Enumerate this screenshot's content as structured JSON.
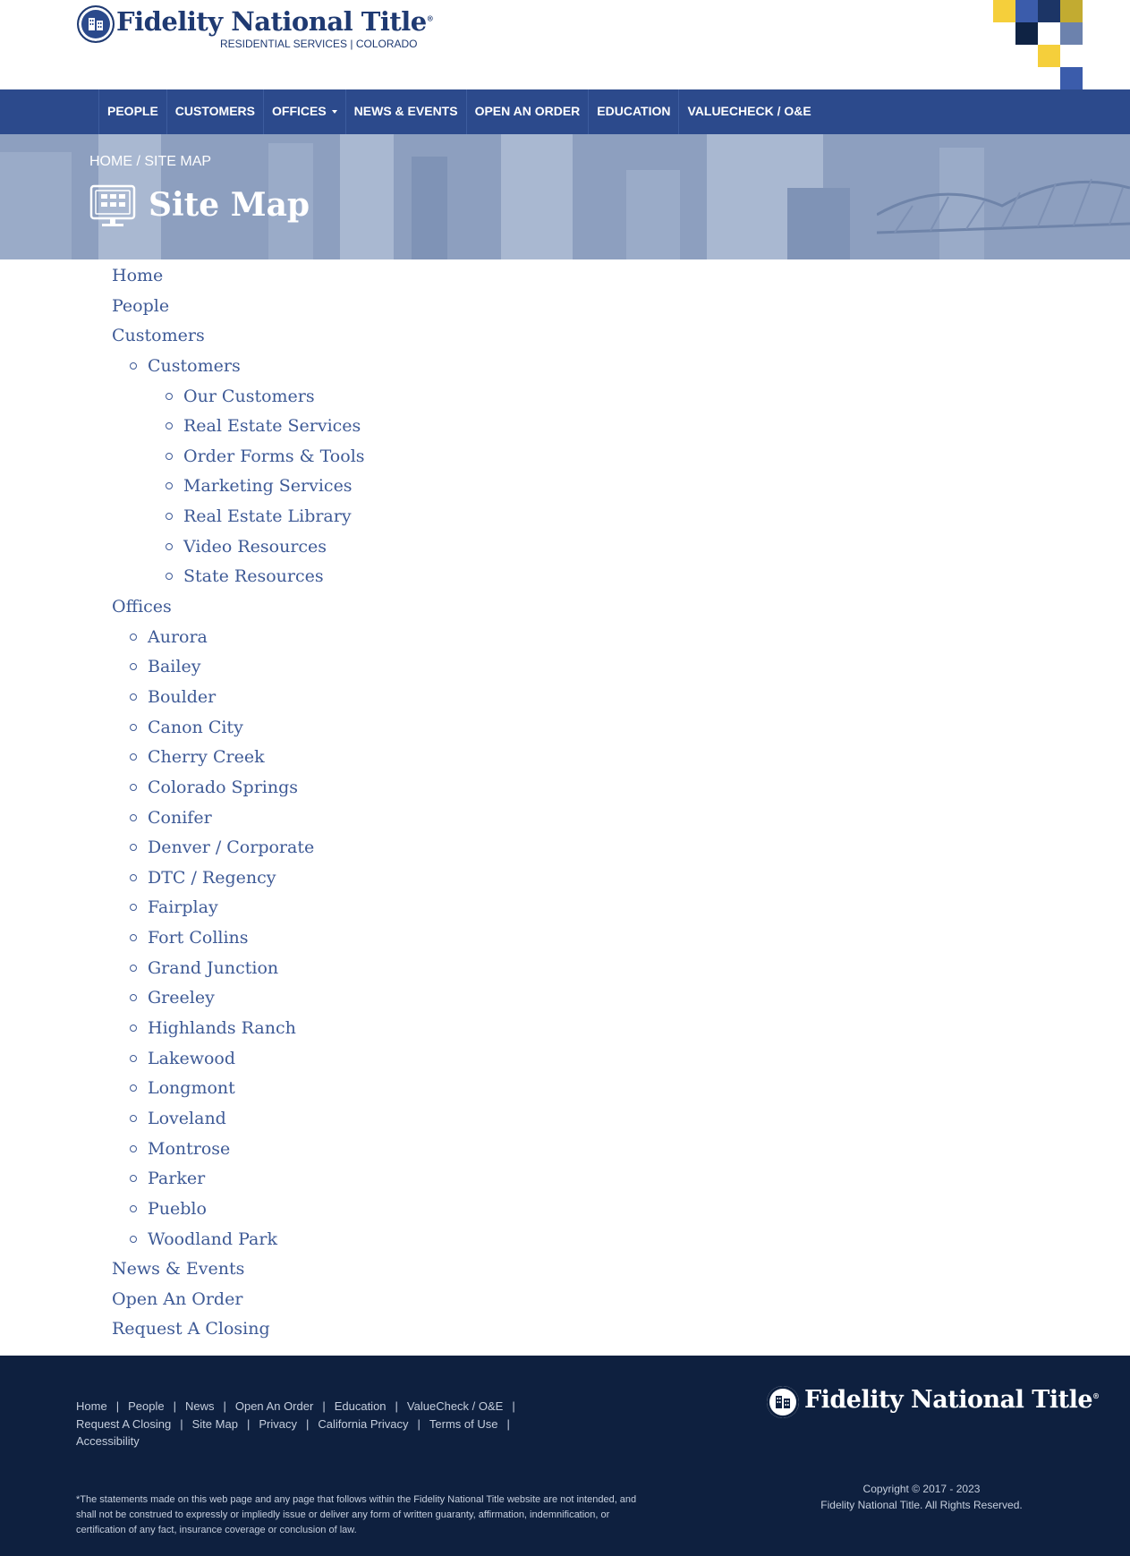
{
  "header": {
    "logo_name": "Fidelity National Title",
    "logo_mark": "®",
    "logo_subtitle": "RESIDENTIAL SERVICES | COLORADO",
    "squares_colors": [
      "#f5cf3b",
      "#3b5cab",
      "#1c3566",
      "#c2ab31",
      "#0f2344",
      "#6c82ad",
      "#f5cf3b",
      "#3b5cab"
    ]
  },
  "nav": {
    "items": [
      {
        "label": "PEOPLE"
      },
      {
        "label": "CUSTOMERS"
      },
      {
        "label": "OFFICES",
        "dropdown": true
      },
      {
        "label": "NEWS & EVENTS"
      },
      {
        "label": "OPEN AN ORDER"
      },
      {
        "label": "EDUCATION"
      },
      {
        "label": "VALUECHECK / O&E"
      }
    ]
  },
  "hero": {
    "breadcrumb_home": "HOME",
    "breadcrumb_sep": "/",
    "breadcrumb_current": "SITE MAP",
    "title": "Site Map",
    "icon": "sitemap-monitor-icon"
  },
  "sitemap": {
    "items": [
      {
        "label": "Home",
        "level": 0
      },
      {
        "label": "People",
        "level": 0
      },
      {
        "label": "Customers",
        "level": 0
      },
      {
        "label": "Customers",
        "level": 1
      },
      {
        "label": "Our Customers",
        "level": 2
      },
      {
        "label": "Real Estate Services",
        "level": 2
      },
      {
        "label": "Order Forms & Tools",
        "level": 2
      },
      {
        "label": "Marketing Services",
        "level": 2
      },
      {
        "label": "Real Estate Library",
        "level": 2
      },
      {
        "label": "Video Resources",
        "level": 2
      },
      {
        "label": "State Resources",
        "level": 2
      },
      {
        "label": "Offices",
        "level": 0
      },
      {
        "label": "Aurora",
        "level": 1
      },
      {
        "label": "Bailey",
        "level": 1
      },
      {
        "label": "Boulder",
        "level": 1
      },
      {
        "label": "Canon City",
        "level": 1
      },
      {
        "label": "Cherry Creek",
        "level": 1
      },
      {
        "label": "Colorado Springs",
        "level": 1
      },
      {
        "label": "Conifer",
        "level": 1
      },
      {
        "label": "Denver / Corporate",
        "level": 1
      },
      {
        "label": "DTC / Regency",
        "level": 1
      },
      {
        "label": "Fairplay",
        "level": 1
      },
      {
        "label": "Fort Collins",
        "level": 1
      },
      {
        "label": "Grand Junction",
        "level": 1
      },
      {
        "label": "Greeley",
        "level": 1
      },
      {
        "label": "Highlands Ranch",
        "level": 1
      },
      {
        "label": "Lakewood",
        "level": 1
      },
      {
        "label": "Longmont",
        "level": 1
      },
      {
        "label": "Loveland",
        "level": 1
      },
      {
        "label": "Montrose",
        "level": 1
      },
      {
        "label": "Parker",
        "level": 1
      },
      {
        "label": "Pueblo",
        "level": 1
      },
      {
        "label": "Woodland Park",
        "level": 1
      },
      {
        "label": "News & Events",
        "level": 0
      },
      {
        "label": "Open An Order",
        "level": 0
      },
      {
        "label": "Request A Closing",
        "level": 0
      }
    ]
  },
  "footer": {
    "links": [
      "Home",
      "People",
      "News",
      "Open An Order",
      "Education",
      "ValueCheck / O&E",
      "Request A Closing",
      "Site Map",
      "Privacy",
      "California Privacy",
      "Terms of Use",
      "Accessibility"
    ],
    "separator": "|",
    "disclaimer": "*The statements made on this web page and any page that follows within the Fidelity National Title website are not intended, and shall not be construed to expressly or impliedly issue or deliver any form of written guaranty, affirmation, indemnification, or certification of any fact, insurance coverage or conclusion of law.",
    "logo_name": "Fidelity National Title",
    "logo_mark": "®",
    "copyright_line1": "Copyright © 2017 - 2023",
    "copyright_line2": "Fidelity National Title. All Rights Reserved."
  },
  "colors": {
    "nav_bg": "#2c4a8c",
    "link": "#3e5a96",
    "footer_bg": "#0e203f",
    "hero_bg": "#8d9fbf"
  }
}
